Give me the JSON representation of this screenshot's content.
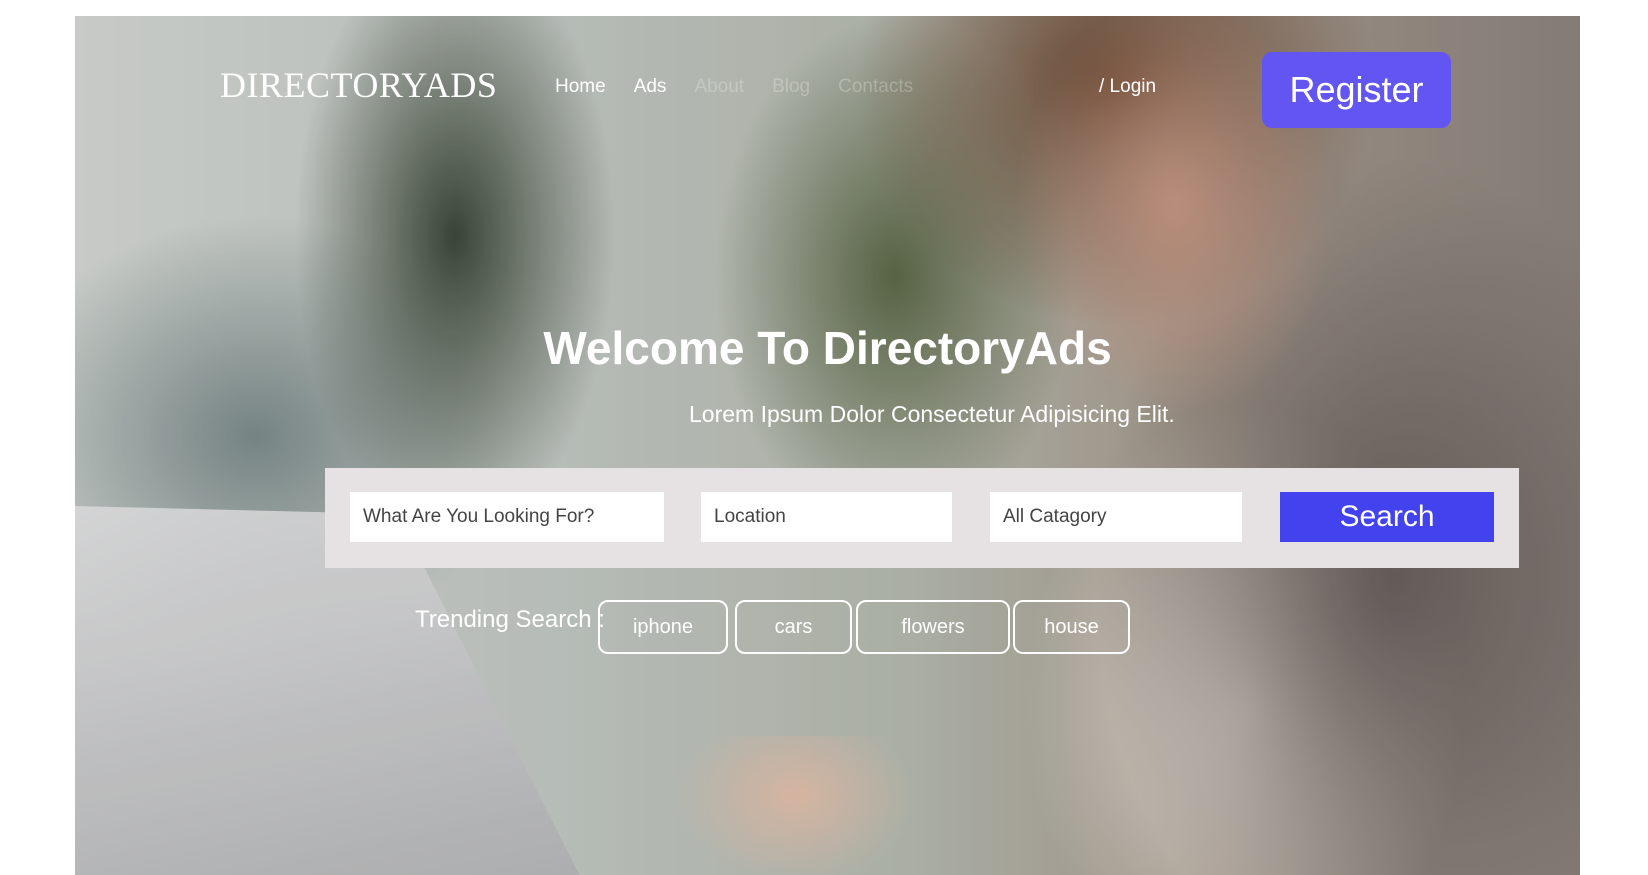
{
  "header": {
    "logo": "DIRECTORYADS",
    "nav": [
      "Home",
      "Ads",
      "About",
      "Blog",
      "Contacts"
    ],
    "login": "/ Login",
    "register": "Register"
  },
  "hero": {
    "title": "Welcome To DirectoryAds",
    "subtitle": "Lorem Ipsum Dolor Consectetur Adipisicing Elit."
  },
  "search": {
    "keyword_placeholder": "What Are You Looking For?",
    "location_placeholder": "Location",
    "category_placeholder": "All Catagory",
    "button": "Search"
  },
  "trending": {
    "label": "Trending Search :",
    "tags": [
      "iphone",
      "cars",
      "flowers",
      "house"
    ]
  },
  "colors": {
    "register": "#6355f2",
    "search_button": "#4242ef",
    "search_panel": "#e6e2e4"
  }
}
